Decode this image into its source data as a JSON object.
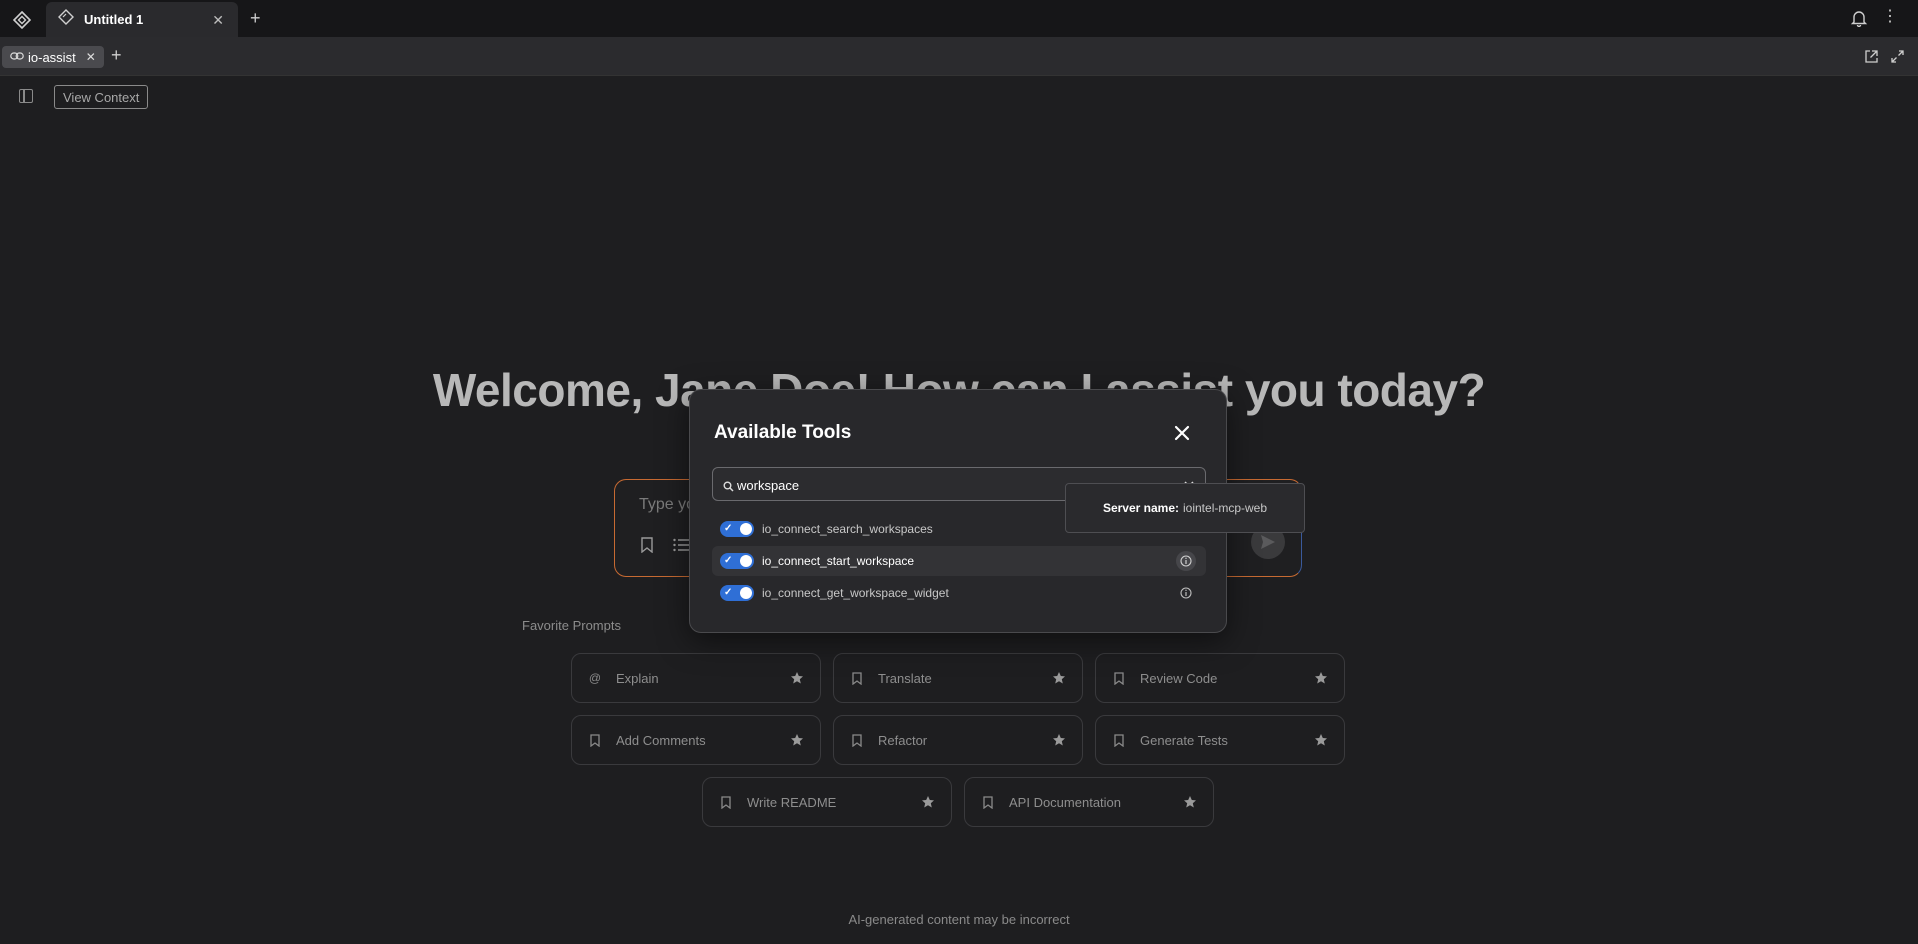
{
  "topbar": {
    "tab_title": "Untitled 1",
    "new_tab": "+",
    "tab_close": "✕",
    "more": "⋮"
  },
  "subbar": {
    "pill_label": "io-assist",
    "pill_close": "✕",
    "add": "+"
  },
  "toolbar": {
    "view_context": "View Context"
  },
  "welcome": "Welcome, Jane Doe! How can I assist you today?",
  "chat": {
    "placeholder": "Type your message..."
  },
  "favorites": {
    "title": "Favorite Prompts",
    "items": [
      {
        "label": "Explain",
        "icon": "at-icon"
      },
      {
        "label": "Translate",
        "icon": "bookmark-icon"
      },
      {
        "label": "Review Code",
        "icon": "bookmark-icon"
      },
      {
        "label": "Add Comments",
        "icon": "bookmark-icon"
      },
      {
        "label": "Refactor",
        "icon": "bookmark-icon"
      },
      {
        "label": "Generate Tests",
        "icon": "bookmark-icon"
      },
      {
        "label": "Write README",
        "icon": "bookmark-icon"
      },
      {
        "label": "API Documentation",
        "icon": "bookmark-icon"
      }
    ]
  },
  "footer_note": "AI-generated content may be incorrect",
  "modal": {
    "title": "Available Tools",
    "search_value": "workspace",
    "tools": [
      {
        "name": "io_connect_search_workspaces",
        "enabled": true
      },
      {
        "name": "io_connect_start_workspace",
        "enabled": true
      },
      {
        "name": "io_connect_get_workspace_widget",
        "enabled": true
      }
    ]
  },
  "tooltip": {
    "key": "Server name:",
    "value": "iointel-mcp-web"
  },
  "colors": {
    "accent": "#2f6fd6",
    "input_border_left": "#c76a32",
    "input_border_right": "#3a5a9c",
    "background": "#1e1e20"
  }
}
